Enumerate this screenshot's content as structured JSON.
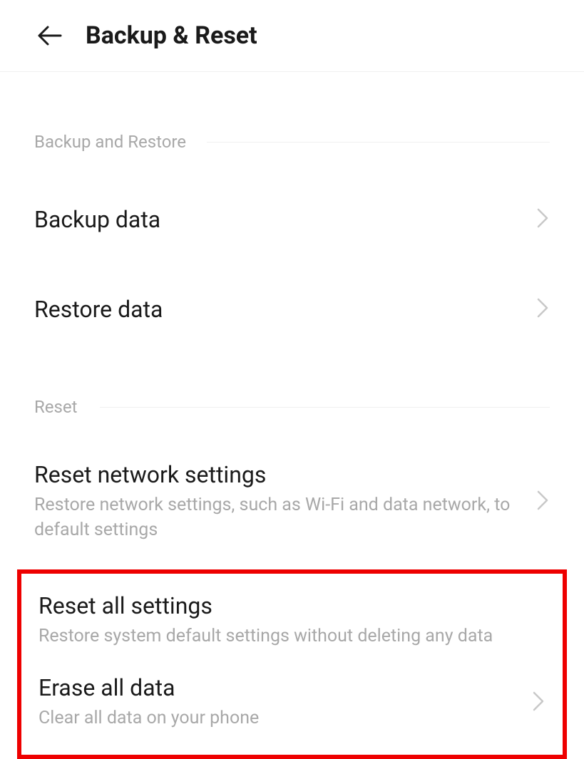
{
  "header": {
    "title": "Backup & Reset"
  },
  "sections": {
    "backup": {
      "header": "Backup and Restore",
      "items": [
        {
          "title": "Backup data"
        },
        {
          "title": "Restore data"
        }
      ]
    },
    "reset": {
      "header": "Reset",
      "items": [
        {
          "title": "Reset network settings",
          "subtitle": "Restore network settings, such as Wi-Fi and data network, to default settings"
        },
        {
          "title": "Reset all settings",
          "subtitle": "Restore system default settings without deleting any data"
        },
        {
          "title": "Erase all data",
          "subtitle": "Clear all data on your phone"
        }
      ]
    }
  }
}
